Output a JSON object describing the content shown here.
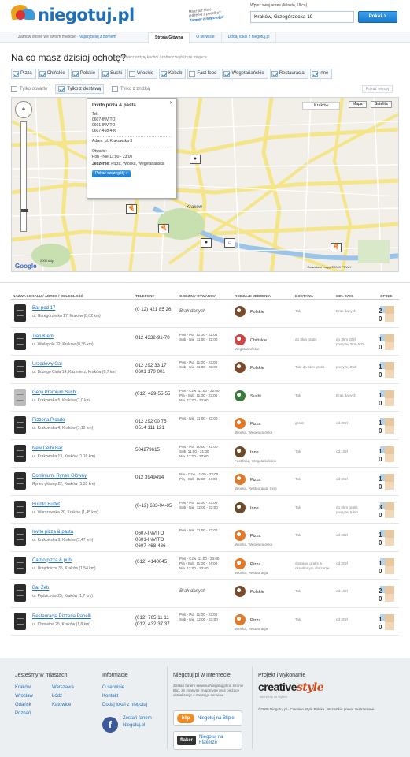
{
  "header": {
    "logo_text": "niegotuj.pl",
    "tagline_lines": [
      "Masz już dość",
      "jedzenia z pudełka?",
      "Zamów z niegotuj.pl"
    ],
    "address_label": "Wpisz swój adres (Miasto, Ulica)",
    "address_value": "Kraków, Grzegórzecka 19",
    "address_button": "Pokaż >"
  },
  "navbar": {
    "left_text": "Zamów online we swoim mieście",
    "left_link": "Najszybciej z domem",
    "tabs": [
      "Strona Główna",
      "O serwisie",
      "Dodaj lokal z niegotuj.pl"
    ]
  },
  "question": "Na co masz dzisiaj ochotę?",
  "question_sub": "— Wybierz rodzaj kuchni i zobacz najbliższe miejsca",
  "categories": [
    {
      "label": "Pizza",
      "checked": true
    },
    {
      "label": "Chińskie",
      "checked": true
    },
    {
      "label": "Polskie",
      "checked": true
    },
    {
      "label": "Sushi",
      "checked": true
    },
    {
      "label": "Włoskie",
      "checked": false
    },
    {
      "label": "Kebab",
      "checked": true
    },
    {
      "label": "Fast food",
      "checked": false
    },
    {
      "label": "Wegetariańskie",
      "checked": true
    },
    {
      "label": "Restauracja",
      "checked": true
    },
    {
      "label": "Inne",
      "checked": true
    }
  ],
  "options": [
    {
      "label": "Tylko otwarte",
      "checked": false
    },
    {
      "label": "Tylko z dostawą",
      "checked": true
    },
    {
      "label": "Tylko z zniżką",
      "checked": false
    }
  ],
  "more_label": "Pokaż więcej",
  "map": {
    "city": "Kraków",
    "city_label": "Kraków",
    "btn_map": "Mapa",
    "btn_sat": "Satelita",
    "google": "Google",
    "copyright": "Zawartość mapy ©2009 PPWK",
    "scale": "2000 stóp",
    "popup": {
      "title": "Invito pizza & pasta",
      "phone_label": "Tel:",
      "phones": [
        "0607-INVITO",
        "0601-INVITO",
        "0607-468-486"
      ],
      "address": "Adres: ul. Krakowska 3",
      "hours_label": "Otwarte:",
      "hours": "Pon - Nie   11:00 - 23:00",
      "food_label": "Jedzenie:",
      "food": "Pizza, Włoska, Wegetariańska",
      "button": "Pokaż szczegóły »"
    }
  },
  "table": {
    "headers": [
      "NAZWA LOKALU / ADRES / ODLEGŁOŚĆ",
      "TELEFONY",
      "GODZINY OTWARCIA",
      "RODZAJE JEDZENIA",
      "DOSTAWA",
      "MIN. ZAM.",
      "OPINIE"
    ],
    "rows": [
      {
        "name": "Bar pod 17",
        "addr": "ul. Grzegórzecka 17, Kraków (0,02 km)",
        "phone": "(0 12) 421 85 26",
        "hours": "Brak danych",
        "food": "Polskie",
        "tags": "",
        "delivery": "Tak",
        "min": "Brak danych",
        "op1": "2",
        "op2": "0",
        "icon": "dark"
      },
      {
        "name": "Tian Kiem",
        "addr": "ul. Wielopole 32, Kraków (0,36 km)",
        "phone": "012 4332-91-70",
        "hours": "Pon - Pią  11:00 - 22:00\nSob - Nie  11:00 - 22:00",
        "food": "Chińskie",
        "tags": "Wegetariańskie",
        "delivery": "do 3km gratis",
        "min": "do 3km 20zł\npowyżej 3km 50zł",
        "op1": "1",
        "op2": "0",
        "icon": "dark"
      },
      {
        "name": "Urzędowy Gal",
        "addr": "ul. Bożego Ciała 14, Kazimierz, Kraków (0,7 km)",
        "phone": "012 292 33 17\n0601 170 001",
        "hours": "Pon - Pią  11:00 - 23:00\nSob - Nie  11:00 - 23:00",
        "food": "Polskie",
        "tags": "",
        "delivery": "Tak, do 5km gratis",
        "min": "powyżej 25zł",
        "op1": "1",
        "op2": "0",
        "icon": "dark"
      },
      {
        "name": "Genji Premium Sushi",
        "addr": "ul. Krakowska 5, Kraków (1,0 km)",
        "phone": "(012) 429-55-55",
        "hours": "Pon - Czw  11:00 - 22:00\nPią - Sob  11:00 - 23:00\nNie  12:00 - 22:00",
        "food": "Sushi",
        "tags": "",
        "delivery": "Tak",
        "min": "Brak danych",
        "op1": "1",
        "op2": "0",
        "icon": "light"
      },
      {
        "name": "Pizzeria Picado",
        "addr": "ul. Krakowska 4, Kraków (1,12 km)",
        "phone": "012 292 00 75\n0514 111 121",
        "hours": "Pon - Nie  11:00 - 23:00",
        "food": "Pizza",
        "tags": "Włoska, Wegetariańska",
        "delivery": "gratis",
        "min": "od 20zł",
        "op1": "1",
        "op2": "0",
        "icon": "dark"
      },
      {
        "name": "New Delhi Bar",
        "addr": "ul. Krakowska 13, Kraków (1,16 km)",
        "phone": "504279615",
        "hours": "Pon - Pią  10:00 - 21:00\nSob  11:00 - 21:00\nNie  12:00 - 20:00",
        "food": "Inne",
        "tags": "Fast food, Wegetariańskie",
        "delivery": "Tak",
        "min": "od 15zł",
        "op1": "1",
        "op2": "0",
        "icon": "dark"
      },
      {
        "name": "Dominium, Rynek Główny",
        "addr": "Rynek główny 22, Kraków (1,33 km)",
        "phone": "012 3949494",
        "hours": "Nie - Czw  11:00 - 23:00\nPią - Sob  11:00 - 24:00",
        "food": "Pizza",
        "tags": "Włoska, Restauracja, Inne",
        "delivery": "Tak",
        "min": "od 20zł",
        "op1": "1",
        "op2": "0",
        "icon": "dark"
      },
      {
        "name": "Burrito Buffet",
        "addr": "ul. Warszawska 20, Kraków (1,45 km)",
        "phone": "(0-12) 633-04-05",
        "hours": "Pon - Pią  11:00 - 23:00\nSob - Nie  12:00 - 23:00",
        "food": "Inne",
        "tags": "",
        "delivery": "Tak",
        "min": "do 5km gratis\npowyżej 5 km",
        "op1": "3",
        "op2": "0",
        "icon": "dark"
      },
      {
        "name": "Invito pizza & pasta",
        "addr": "ul. Krakowska 3, Kraków (1,47 km)",
        "phone": "0607-INVITO\n0601-INVITO\n0607-468-486",
        "hours": "Pon - Nie  11:00 - 23:00",
        "food": "Pizza",
        "tags": "Włoska, Wegetariańska",
        "delivery": "Tak",
        "min": "od 25zł",
        "op1": "1",
        "op2": "0",
        "icon": "dark"
      },
      {
        "name": "Calzio pizza & pub",
        "addr": "ul. Urzędnicza 35, Kraków (1,54 km)",
        "phone": "(012) 4140045",
        "hours": "Pon - Czw  11:00 - 23:00\nPią - Sob  11:00 - 24:00\nNie  12:00 - 23:00",
        "food": "Pizza",
        "tags": "Włoska, Restauracja",
        "delivery": "dostawa gratis w\nokreślonym obszarze",
        "min": "od 20zł",
        "op1": "1",
        "op2": "0",
        "icon": "dark"
      },
      {
        "name": "Bar Żeb",
        "addr": "ul. Pędzichów 25, Kraków (1,7 km)",
        "phone": "",
        "hours": "Brak danych",
        "food": "Polskie",
        "tags": "",
        "delivery": "Tak",
        "min": "od 15zł",
        "op1": "2",
        "op2": "0",
        "icon": "dark"
      },
      {
        "name": "Restauracja Pizzeria Panelli",
        "addr": "ul. Chmielna 25, Kraków (1,8 km)",
        "phone": "(012) 765 11 11\n(012) 432 37 37",
        "hours": "Pon - Pią  11:00 - 23:00\nSob - Nie  12:00 - 23:00",
        "food": "Pizza",
        "tags": "Włoska, Restauracja",
        "delivery": "Tak",
        "min": "od 20zł",
        "op1": "1",
        "op2": "0",
        "icon": "dark"
      }
    ]
  },
  "footer": {
    "cities_title": "Jesteśmy w miastach",
    "cities": [
      "Kraków",
      "Wrocław",
      "Gdańsk",
      "Poznań",
      "Warszawa",
      "Łódź",
      "Katowice"
    ],
    "info_title": "Informacje",
    "info_links": [
      "O serwisie",
      "Kontakt",
      "Dodaj lokal z niegotuj"
    ],
    "fb_label": "Zostań fanem",
    "fb_label2": "Niegotuj.pl",
    "internet_title": "Niegotuj.pl w Internecie",
    "internet_text": "Zostań fanem serwisu Niegotuj.pl na stronie Blip, ze znanymi znajomymi oraz bieżące aktualizacje z naszego serwisu.",
    "blip_badge": "blip",
    "blip_label": "Niegotuj na Blipie",
    "flaker_badge": "flaker",
    "flaker_label1": "Niegotuj na",
    "flaker_label2": "Flakerze",
    "project_title": "Projekt i wykonanie",
    "creative": "creative",
    "style": "style",
    "creative_sub": "tworzymy ze stylem",
    "copyright": "©2009 Niegotuj.pl · Creative Style Polska. Wszystkie prawa zastrzeżone."
  }
}
